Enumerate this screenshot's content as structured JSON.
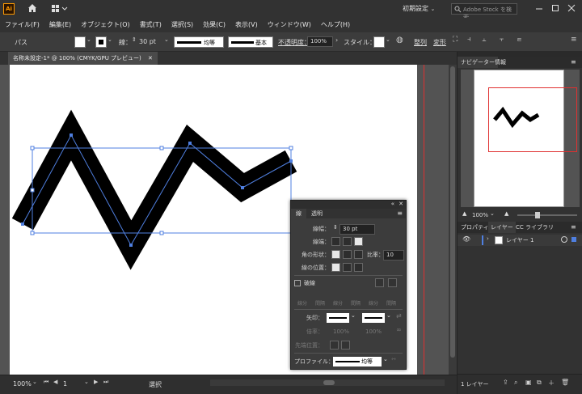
{
  "app": {
    "logo": "Ai",
    "workspace": "初期設定",
    "stock_placeholder": "Adobe Stock を検索"
  },
  "menu": [
    "ファイル(F)",
    "編集(E)",
    "オブジェクト(O)",
    "書式(T)",
    "選択(S)",
    "効果(C)",
    "表示(V)",
    "ウィンドウ(W)",
    "ヘルプ(H)"
  ],
  "control": {
    "object_type": "パス",
    "stroke_label": "線：",
    "stroke_weight": "30 pt",
    "profile_label": "均等",
    "brush_label": "基本",
    "opacity_label": "不透明度：",
    "opacity_value": "100%",
    "style_label": "スタイル：",
    "align_label": "整列",
    "transform_label": "変形"
  },
  "document": {
    "tab_title": "名称未設定-1* @ 100% (CMYK/GPU プレビュー)"
  },
  "statusbar": {
    "zoom": "100%",
    "artboard_num": "1",
    "tool": "選択"
  },
  "navigator": {
    "tab_navigator": "ナビゲーター",
    "tab_info": "情報",
    "zoom": "100%"
  },
  "layers_panel": {
    "tab_properties": "プロパティ",
    "tab_layers": "レイヤー",
    "tab_libraries": "CC ライブラリ",
    "layer_name": "レイヤー 1",
    "footer_count": "1 レイヤー"
  },
  "stroke_panel": {
    "tab_stroke": "線",
    "tab_transparency": "透明",
    "weight_label": "線幅：",
    "weight_value": "30 pt",
    "cap_label": "線端：",
    "corner_label": "角の形状：",
    "limit_label": "比率：",
    "limit_value": "10",
    "align_label": "線の位置：",
    "dashed_label": "破線",
    "dash_labels": [
      "線分",
      "間隔",
      "線分",
      "間隔",
      "線分",
      "間隔"
    ],
    "arrow_label": "矢印：",
    "scale_label": "倍率：",
    "scale_values": [
      "100%",
      "100%"
    ],
    "align_arrow_label": "先端位置：",
    "profile_label": "プロファイル：",
    "profile_value": "均等"
  },
  "colors": {
    "selection": "#4f7fe0",
    "bleed": "#e03030",
    "artboard": "#ffffff"
  }
}
